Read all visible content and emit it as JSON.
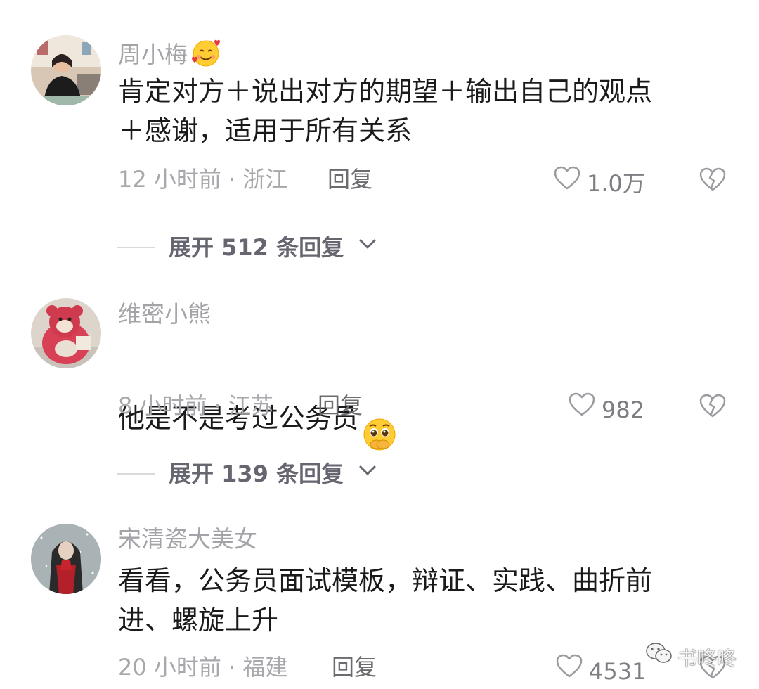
{
  "comments": [
    {
      "username": "周小梅",
      "username_emoji": "smiling-face-with-hearts-icon",
      "text": "肯定对方＋说出对方的期望＋输出自己的观点\n＋感谢，适用于所有关系",
      "time_location": "12 小时前 · 浙江",
      "reply_label": "回复",
      "likes": "1.0万",
      "expand_label": "展开 512 条回复"
    },
    {
      "username": "维密小熊",
      "text": "他是不是考过公务员",
      "text_emoji": "pleading-face-icon",
      "time_location": "8 小时前 · 江苏",
      "reply_label": "回复",
      "likes": "982",
      "expand_label": "展开 139 条回复"
    },
    {
      "username": "宋清瓷大美女",
      "text": "看看，公务员面试模板，辩证、实践、曲折前\n进、螺旋上升",
      "time_location": "20 小时前 · 福建",
      "reply_label": "回复",
      "likes": "4531"
    }
  ],
  "watermark": {
    "icon": "wechat-icon",
    "text": "书咚咚"
  },
  "colors": {
    "username": "#a3a3a8",
    "text": "#1a1a1a",
    "meta": "#a7a7ac",
    "reply": "#6b6b70",
    "expand": "#666670"
  }
}
